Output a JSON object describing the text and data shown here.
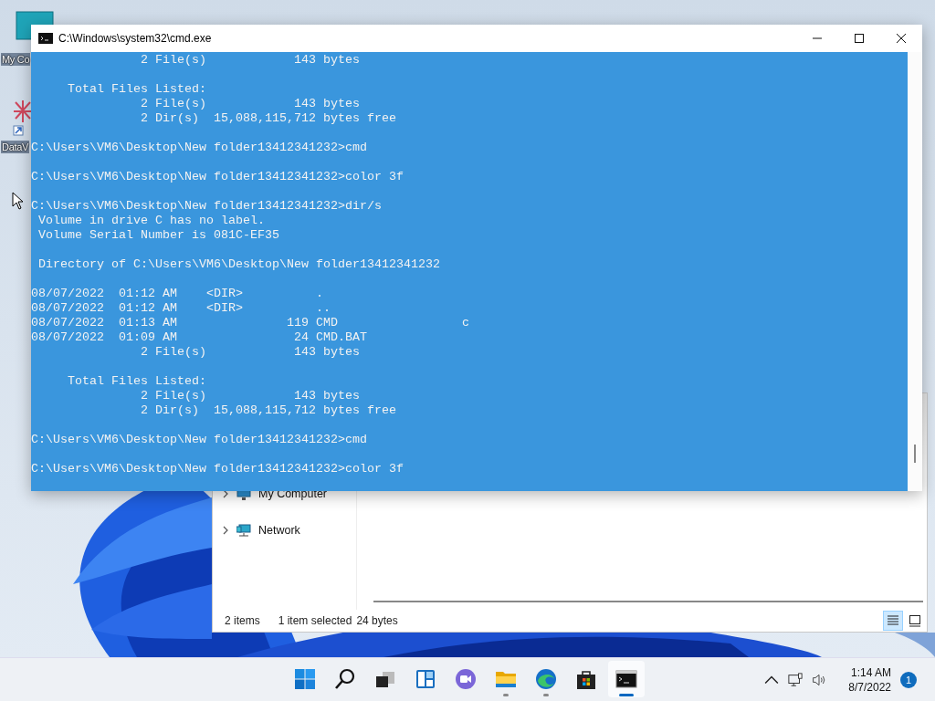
{
  "desktop": {
    "icons": [
      {
        "label": "My Co",
        "kind": "monitor"
      },
      {
        "label": "DataV",
        "kind": "shortcut"
      }
    ]
  },
  "console_window": {
    "title": "C:\\Windows\\system32\\cmd.exe",
    "blocks": [
      [
        "               2 File(s)            143 bytes"
      ],
      [
        "     Total Files Listed:",
        "               2 File(s)            143 bytes",
        "               2 Dir(s)  15,088,115,712 bytes free"
      ],
      [
        "C:\\Users\\VM6\\Desktop\\New folder13412341232>cmd"
      ],
      [
        "C:\\Users\\VM6\\Desktop\\New folder13412341232>color 3f"
      ],
      [
        "C:\\Users\\VM6\\Desktop\\New folder13412341232>dir/s",
        " Volume in drive C has no label.",
        " Volume Serial Number is 081C-EF35"
      ],
      [
        " Directory of C:\\Users\\VM6\\Desktop\\New folder13412341232"
      ],
      [
        "08/07/2022  01:12 AM    <DIR>          .",
        "08/07/2022  01:12 AM    <DIR>          ..",
        "08/07/2022  01:13 AM               119 CMD                 c",
        "08/07/2022  01:09 AM                24 CMD.BAT",
        "               2 File(s)            143 bytes"
      ],
      [
        "     Total Files Listed:",
        "               2 File(s)            143 bytes",
        "               2 Dir(s)  15,088,115,712 bytes free"
      ],
      [
        "C:\\Users\\VM6\\Desktop\\New folder13412341232>cmd"
      ],
      [
        "C:\\Users\\VM6\\Desktop\\New folder13412341232>color 3f"
      ]
    ]
  },
  "explorer_window": {
    "nav_items": [
      {
        "label": "My Computer",
        "kind": "monitor",
        "expanded": false
      },
      {
        "label": "Network",
        "kind": "network",
        "expanded": false
      }
    ],
    "status_bar": {
      "items": "2 items",
      "selection": "1 item selected",
      "size": "24 bytes"
    },
    "views": [
      {
        "kind": "details",
        "selected": true
      },
      {
        "kind": "large-icons",
        "selected": false
      }
    ]
  },
  "taskbar": {
    "apps": [
      {
        "kind": "start",
        "running": false,
        "active": false
      },
      {
        "kind": "search",
        "running": false,
        "active": false
      },
      {
        "kind": "task-view",
        "running": false,
        "active": false
      },
      {
        "kind": "widgets",
        "running": false,
        "active": false
      },
      {
        "kind": "chat",
        "running": false,
        "active": false
      },
      {
        "kind": "file-explorer",
        "running": true,
        "active": false
      },
      {
        "kind": "edge",
        "running": true,
        "active": false
      },
      {
        "kind": "store",
        "running": false,
        "active": false
      },
      {
        "kind": "terminal",
        "running": true,
        "active": true
      }
    ],
    "clock": {
      "time": "1:14 AM",
      "date": "8/7/2022"
    },
    "notifications": "1"
  }
}
